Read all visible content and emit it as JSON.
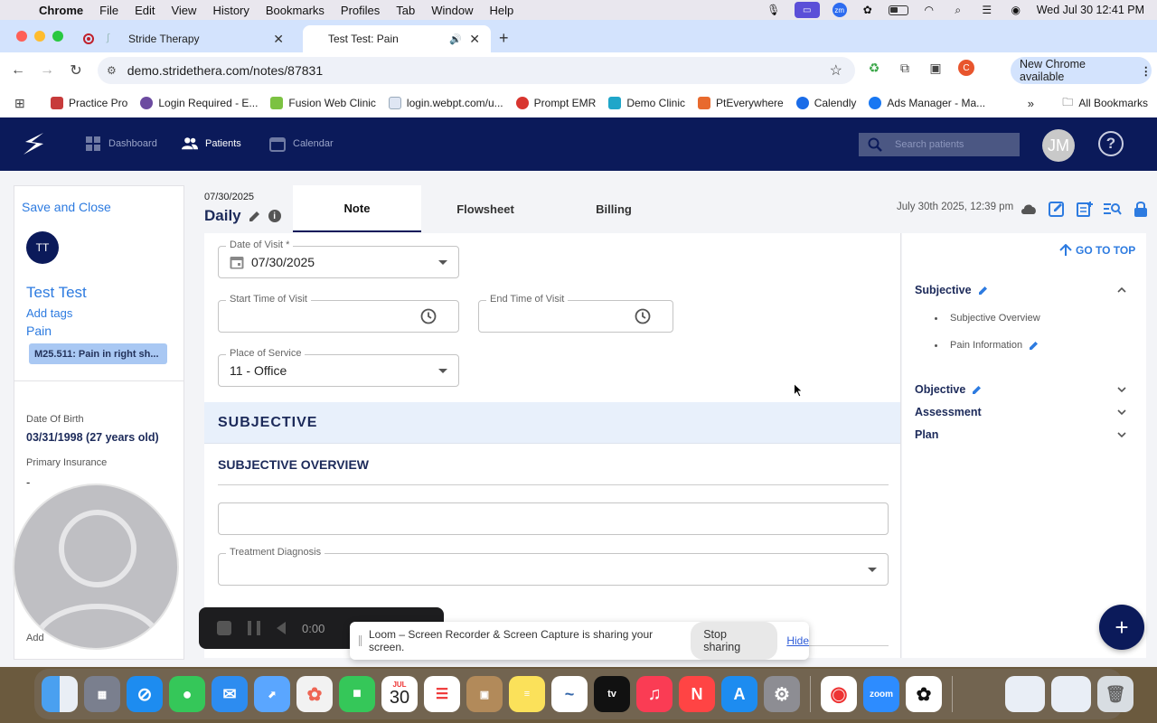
{
  "menubar": {
    "app": "Chrome",
    "items": [
      "File",
      "Edit",
      "View",
      "History",
      "Bookmarks",
      "Profiles",
      "Tab",
      "Window",
      "Help"
    ],
    "clock": "Wed Jul 30  12:41 PM"
  },
  "browser": {
    "tabs": [
      {
        "title": "Stride Therapy"
      },
      {
        "title": "Test Test: Pain"
      }
    ],
    "url": "demo.stridethera.com/notes/87831",
    "new_chrome": "New Chrome available",
    "bookmarks": [
      "Practice Pro",
      "Login Required - E...",
      "Fusion Web Clinic",
      "login.webpt.com/u...",
      "Prompt EMR",
      "Demo Clinic",
      "PtEverywhere",
      "Calendly",
      "Ads Manager - Ma..."
    ],
    "all_bookmarks": "All Bookmarks",
    "profile_initial": "C"
  },
  "app": {
    "nav": {
      "dashboard": "Dashboard",
      "patients": "Patients",
      "calendar": "Calendar"
    },
    "search_placeholder": "Search patients",
    "user_initials": "JM"
  },
  "patient": {
    "save_close": "Save and Close",
    "initials": "TT",
    "name": "Test Test",
    "add_tags": "Add tags",
    "case": "Pain",
    "diagnosis_chip": "M25.511: Pain in right sh...",
    "dob_label": "Date Of Birth",
    "dob_value": "03/31/1998 (27 years old)",
    "insurance_label": "Primary Insurance",
    "insurance_value": "-",
    "address_label": "Add"
  },
  "note": {
    "date": "07/30/2025",
    "type": "Daily",
    "tabs": [
      "Note",
      "Flowsheet",
      "Billing"
    ],
    "timestamp": "July 30th 2025, 12:39 pm"
  },
  "form": {
    "date_of_visit_label": "Date of Visit *",
    "date_of_visit_value": "07/30/2025",
    "start_time_label": "Start Time of Visit",
    "end_time_label": "End Time of Visit",
    "place_label": "Place of Service",
    "place_value": "11 - Office",
    "section": "SUBJECTIVE",
    "subsection": "SUBJECTIVE OVERVIEW",
    "treatment_dx_label": "Treatment Diagnosis"
  },
  "outline": {
    "go_top": "GO TO TOP",
    "subjective": "Subjective",
    "subjective_items": [
      "Subjective Overview",
      "Pain Information"
    ],
    "objective": "Objective",
    "assessment": "Assessment",
    "plan": "Plan"
  },
  "loom": {
    "timer": "0:00",
    "share_text": "Loom – Screen Recorder & Screen Capture is sharing your screen.",
    "stop": "Stop sharing",
    "hide": "Hide"
  },
  "dock": {
    "calendar_month": "JUL",
    "calendar_day": "30",
    "apple_tv": "tv",
    "zoom": "zoom"
  },
  "colors": {
    "navy": "#0b1a5a",
    "link_blue": "#2d7be0",
    "subjective_band": "#e8f0fb"
  }
}
